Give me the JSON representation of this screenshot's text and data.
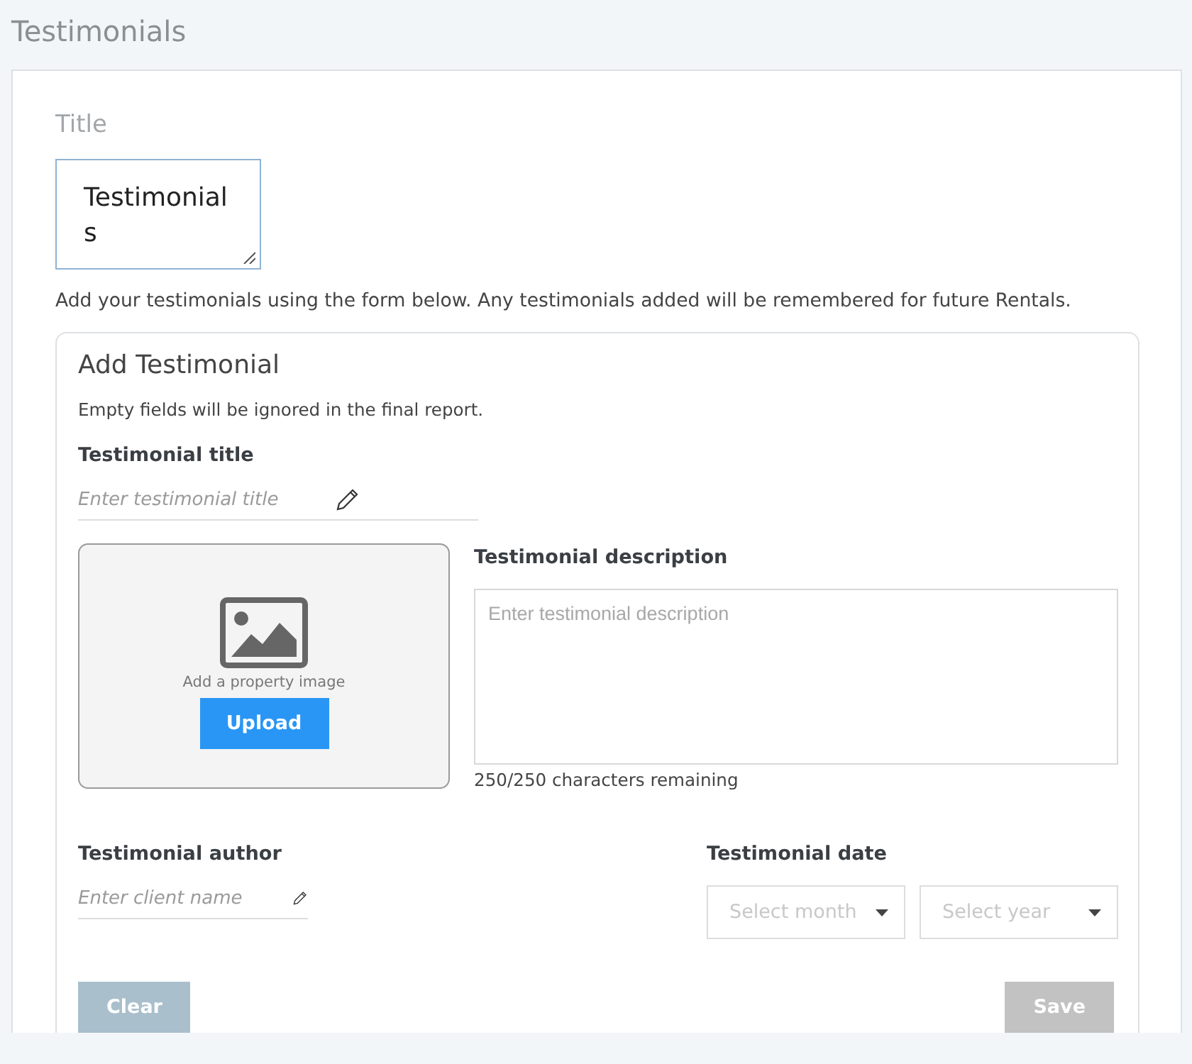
{
  "page_title": "Testimonials",
  "title_field": {
    "label": "Title",
    "value": "Testimonials"
  },
  "intro": "Add your testimonials using the form below. Any testimonials added will be remembered for future Rentals.",
  "card": {
    "heading": "Add Testimonial",
    "note": "Empty fields will be ignored in the final report.",
    "title_field": {
      "label": "Testimonial title",
      "placeholder": "Enter testimonial title"
    },
    "image": {
      "caption": "Add a property image",
      "button": "Upload"
    },
    "description": {
      "label": "Testimonial description",
      "placeholder": "Enter testimonial description",
      "counter": "250/250 characters remaining"
    },
    "author": {
      "label": "Testimonial author",
      "placeholder": "Enter client name"
    },
    "date": {
      "label": "Testimonial date",
      "selects": [
        {
          "placeholder": "Select month"
        },
        {
          "placeholder": "Select year"
        }
      ]
    },
    "buttons": [
      {
        "label": "Clear",
        "kind": "clear",
        "disabled": true
      },
      {
        "label": "Save",
        "kind": "save",
        "disabled": true
      }
    ]
  }
}
